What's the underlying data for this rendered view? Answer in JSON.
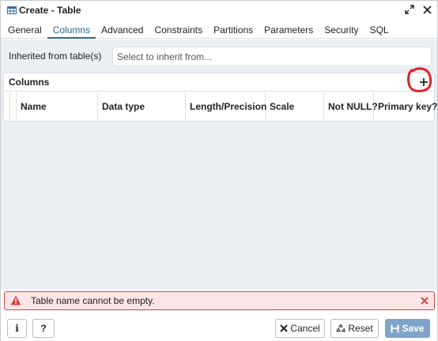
{
  "window": {
    "title": "Create - Table",
    "icon": "table-icon",
    "actions": [
      "maximize-icon",
      "close-icon"
    ]
  },
  "tabs": [
    {
      "label": "General",
      "active": false
    },
    {
      "label": "Columns",
      "active": true
    },
    {
      "label": "Advanced",
      "active": false
    },
    {
      "label": "Constraints",
      "active": false
    },
    {
      "label": "Partitions",
      "active": false
    },
    {
      "label": "Parameters",
      "active": false
    },
    {
      "label": "Security",
      "active": false
    },
    {
      "label": "SQL",
      "active": false
    }
  ],
  "inherit": {
    "label": "Inherited from table(s)",
    "placeholder": "Select to inherit from..."
  },
  "columns_panel": {
    "title": "Columns",
    "add_icon": "plus-icon",
    "headers": [
      "Name",
      "Data type",
      "Length/Precision",
      "Scale",
      "Not NULL?",
      "Primary key?"
    ]
  },
  "error": {
    "message": "Table name cannot be empty.",
    "icon": "warning-icon",
    "color": "#d04545"
  },
  "footer": {
    "info_label": "i",
    "help_label": "?",
    "cancel_label": "Cancel",
    "reset_label": "Reset",
    "save_label": "Save"
  },
  "colors": {
    "accent": "#326690",
    "save_button": "#7fa4c8",
    "annotation": "#e0202a"
  }
}
